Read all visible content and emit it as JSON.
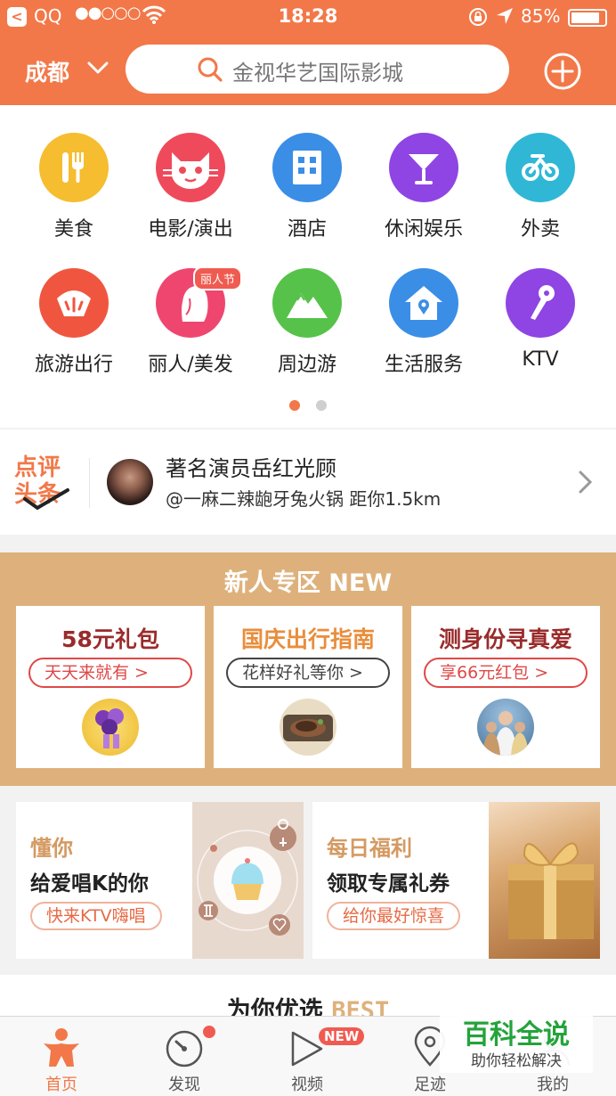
{
  "status_bar": {
    "back_glyph": "<",
    "app": "QQ",
    "signal": "●●○○○",
    "time": "18:28",
    "battery": "85%",
    "battery_level": 0.85
  },
  "header": {
    "city": "成都",
    "search_text": "金视华艺国际影城"
  },
  "categories": [
    {
      "label": "美食",
      "icon": "cutlery-icon",
      "color": "#f5bd2f"
    },
    {
      "label": "电影/演出",
      "icon": "cat-icon",
      "color": "#ef4a5b"
    },
    {
      "label": "酒店",
      "icon": "hotel-icon",
      "color": "#3a8ee6"
    },
    {
      "label": "休闲娱乐",
      "icon": "cocktail-icon",
      "color": "#8e45e3"
    },
    {
      "label": "外卖",
      "icon": "scooter-icon",
      "color": "#30b7d6"
    },
    {
      "label": "旅游出行",
      "icon": "travel-icon",
      "color": "#f0563f"
    },
    {
      "label": "丽人/美发",
      "icon": "beauty-icon",
      "color": "#ef466f",
      "badge": "丽人节"
    },
    {
      "label": "周边游",
      "icon": "mountain-icon",
      "color": "#56c24a"
    },
    {
      "label": "生活服务",
      "icon": "home-service-icon",
      "color": "#3a8ee6"
    },
    {
      "label": "KTV",
      "icon": "microphone-icon",
      "color": "#8e45e3"
    }
  ],
  "page_dots": {
    "active": 1,
    "count": 2
  },
  "headline": {
    "logo_top": "点评",
    "logo_bottom": "头条",
    "title": "著名演员岳红光顾",
    "subtitle": "@一麻二辣龅牙兔火锅 距你1.5km"
  },
  "new_zone": {
    "title": "新人专区 NEW",
    "cards": [
      {
        "title": "58元礼包",
        "title_color": "#9a2b2b",
        "pill": "天天来就有 >",
        "pill_color": "#e04848"
      },
      {
        "title": "国庆出行指南",
        "title_color": "#e88e3c",
        "pill": "花样好礼等你 >",
        "pill_color": "#444444"
      },
      {
        "title": "测身份寻真爱",
        "title_color": "#9a2b2b",
        "pill": "享66元红包 >",
        "pill_color": "#e04848"
      }
    ]
  },
  "promos": [
    {
      "tag": "懂你",
      "title": "给爱唱K的你",
      "pill": "快来KTV嗨唱"
    },
    {
      "tag": "每日福利",
      "title": "领取专属礼券",
      "pill": "给你最好惊喜"
    }
  ],
  "recommend": {
    "title": "为你优选 ",
    "best": "BEST"
  },
  "tabs": [
    {
      "label": "首页",
      "active": true
    },
    {
      "label": "发现"
    },
    {
      "label": "视频",
      "badge": "NEW"
    },
    {
      "label": "足迹"
    },
    {
      "label": "我的"
    }
  ],
  "watermark": {
    "main": "百科全说",
    "sub": "助你轻松解决"
  }
}
